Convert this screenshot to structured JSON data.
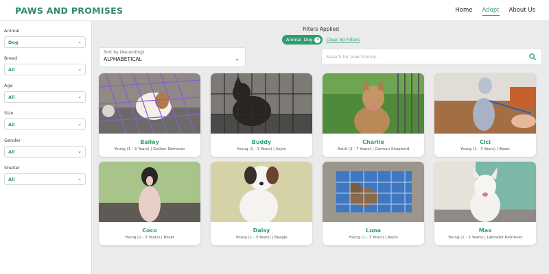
{
  "header": {
    "logo": "PAWS AND PROMISES",
    "nav": [
      {
        "label": "Home",
        "active": false
      },
      {
        "label": "Adopt",
        "active": true
      },
      {
        "label": "About Us",
        "active": false
      }
    ]
  },
  "sidebar": {
    "filters": [
      {
        "label": "Animal",
        "value": "Dog"
      },
      {
        "label": "Breed",
        "value": "All"
      },
      {
        "label": "Age",
        "value": "All"
      },
      {
        "label": "Size",
        "value": "All"
      },
      {
        "label": "Gender",
        "value": "All"
      },
      {
        "label": "Shelter",
        "value": "All"
      }
    ]
  },
  "main": {
    "filters_title": "Filters Applied",
    "chip": {
      "label": "Animal",
      "value": "Dog"
    },
    "clear_label": "Clear All Filters",
    "sort": {
      "label": "Sort by (Ascending)",
      "value": "ALPHABETICAL"
    },
    "search": {
      "placeholder": "Search for paw friends...",
      "value": ""
    },
    "pets": [
      {
        "name": "Bailey",
        "meta": "Young (1 - 3 Years) | Golden Retriever"
      },
      {
        "name": "Buddy",
        "meta": "Young (1 - 3 Years) | Aspin"
      },
      {
        "name": "Charlie",
        "meta": "Adult (3 - 7 Years) | German Shepherd"
      },
      {
        "name": "Cici",
        "meta": "Young (1 - 3 Years) | Boxer"
      },
      {
        "name": "Coco",
        "meta": "Young (1 - 3 Years) | Boxer"
      },
      {
        "name": "Daisy",
        "meta": "Young (1 - 3 Years) | Beagle"
      },
      {
        "name": "Luna",
        "meta": "Young (1 - 3 Years) | Aspin"
      },
      {
        "name": "Max",
        "meta": "Young (1 - 3 Years) | Labrador Retriever"
      }
    ]
  },
  "colors": {
    "accent": "#2e9e70",
    "logo": "#2e8b64",
    "background": "#ebebeb"
  }
}
